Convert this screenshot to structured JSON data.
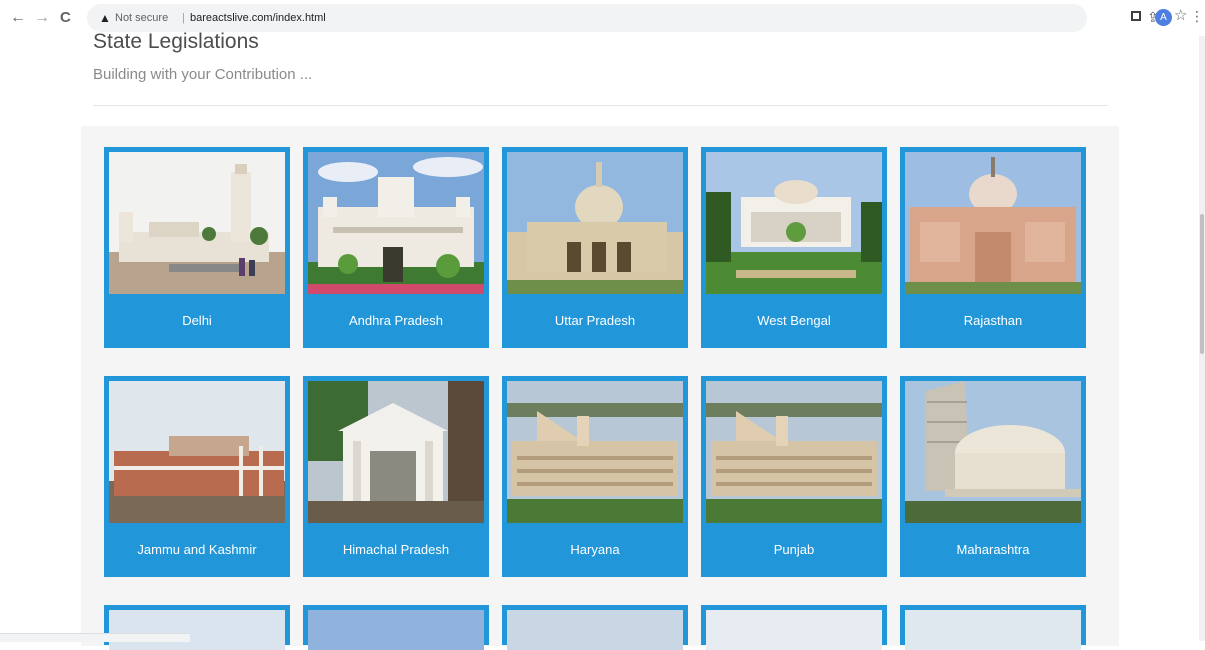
{
  "browser": {
    "security_label": "Not secure",
    "separator": "|",
    "url": "bareactslive.com/index.html",
    "avatar_letter": "A"
  },
  "header": {
    "title": "State Legislations",
    "subtitle": "Building with your Contribution ..."
  },
  "cards": [
    {
      "label": "Delhi"
    },
    {
      "label": "Andhra Pradesh"
    },
    {
      "label": "Uttar Pradesh"
    },
    {
      "label": "West Bengal"
    },
    {
      "label": "Rajasthan"
    },
    {
      "label": "Jammu and Kashmir"
    },
    {
      "label": "Himachal Pradesh"
    },
    {
      "label": "Haryana"
    },
    {
      "label": "Punjab"
    },
    {
      "label": "Maharashtra"
    }
  ],
  "colors": {
    "card_accent": "#2196d9",
    "panel_bg": "#f5f5f5"
  }
}
